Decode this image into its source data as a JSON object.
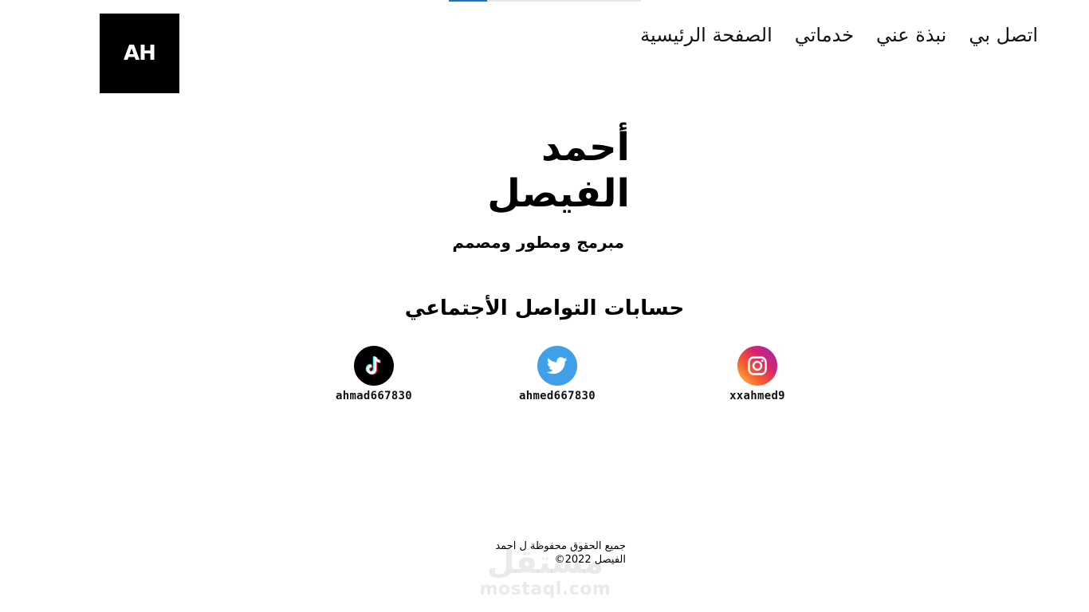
{
  "logo": {
    "text": "AH"
  },
  "nav": {
    "items": [
      {
        "label": "الصفحة الرئيسية"
      },
      {
        "label": "خدماتي"
      },
      {
        "label": "نبذة عني"
      },
      {
        "label": "اتصل بي"
      }
    ]
  },
  "hero": {
    "name_line1": "أحمد",
    "name_line2": "الفيصل",
    "subtitle": "مبرمج ومطور ومصمم"
  },
  "social": {
    "title": "حسابات التواصل الأجتماعي",
    "accounts": [
      {
        "platform": "tiktok-icon",
        "handle": "ahmad667830",
        "color": "#000000"
      },
      {
        "platform": "twitter-icon",
        "handle": "ahmed667830",
        "color": "#3f9fe9"
      },
      {
        "platform": "instagram-icon",
        "handle": "xxahmed9",
        "color": "#d6246e"
      }
    ]
  },
  "footer": {
    "line1": "جميع الحقوق محفوظة ل احمد",
    "line2": "الفيصل 2022©"
  },
  "watermark": {
    "arabic": "مستقل",
    "latin": "mostaql.com"
  }
}
